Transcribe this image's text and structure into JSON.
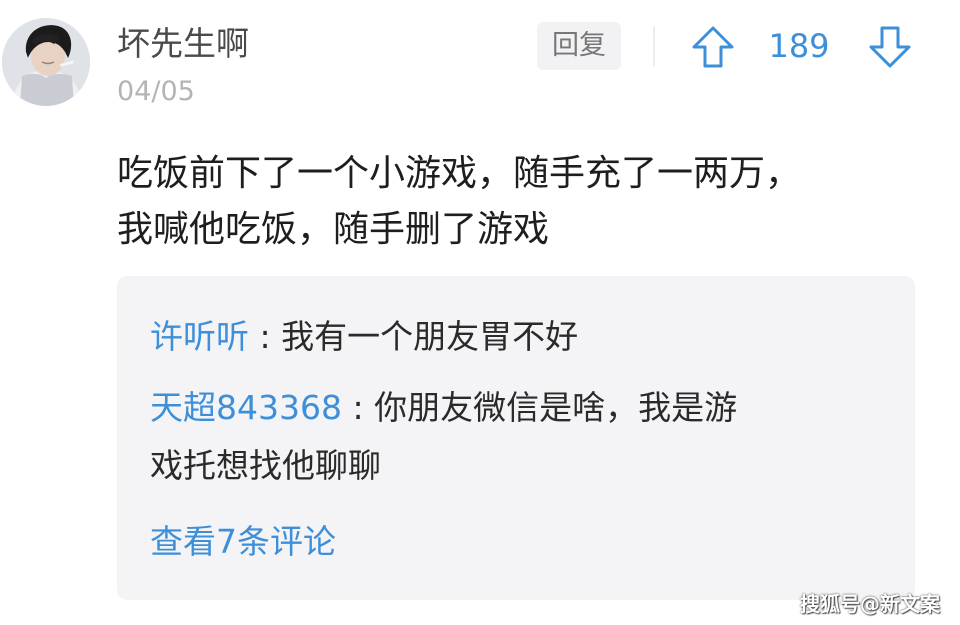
{
  "comment": {
    "username": "坏先生啊",
    "date": "04/05",
    "reply_label": "回复",
    "vote_count": "189",
    "avatar_icon": "user-avatar-photo",
    "content_lines": [
      "吃饭前下了一个小游戏，随手充了一两万，",
      "我喊他吃饭，随手删了游戏"
    ]
  },
  "replies": [
    {
      "author": "许听听",
      "separator": " : ",
      "lines": [
        "我有一个朋友胃不好"
      ]
    },
    {
      "author": "天超843368",
      "separator": " : ",
      "lines": [
        "你朋友微信是啥，我是游",
        "戏托想找他聊聊"
      ]
    }
  ],
  "view_more": "查看7条评论",
  "watermark": "搜狐号@新文案",
  "colors": {
    "accent": "#3d8fd9",
    "reply_bg": "#f4f4f6",
    "text": "#1e1e1e",
    "muted": "#b4b4b4"
  },
  "icons": {
    "upvote": "arrow-up-icon",
    "downvote": "arrow-down-icon"
  }
}
